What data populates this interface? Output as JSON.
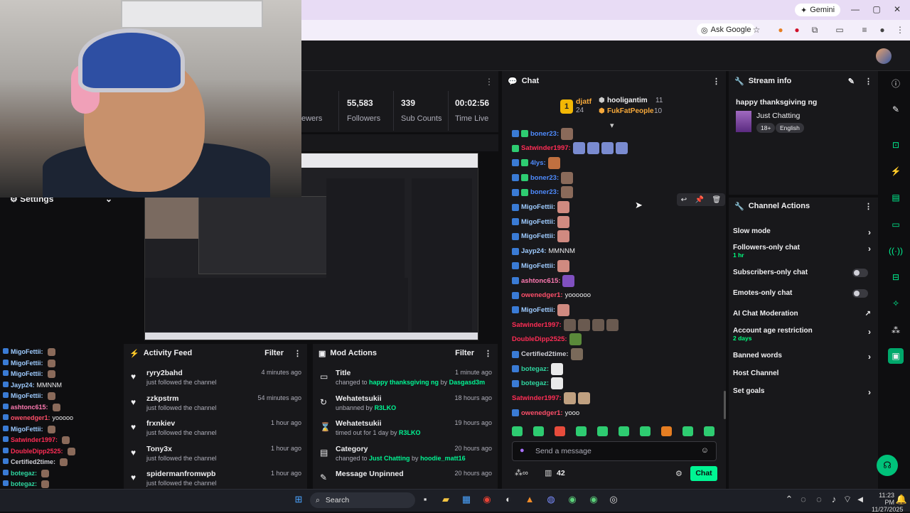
{
  "browser": {
    "gemini_label": "Gemini",
    "ask_google": "Ask Google"
  },
  "stats": [
    {
      "value": "",
      "label": "ewers"
    },
    {
      "value": "55,583",
      "label": "Followers"
    },
    {
      "value": "339",
      "label": "Sub Counts"
    },
    {
      "value": "00:02:56",
      "label": "Time Live"
    }
  ],
  "left": {
    "settings_label": "Settings",
    "chat": [
      {
        "user": "MigoFettii:",
        "color": "#9ecbff",
        "msg": ""
      },
      {
        "user": "MigoFettii:",
        "color": "#9ecbff",
        "msg": ""
      },
      {
        "user": "MigoFettii:",
        "color": "#9ecbff",
        "msg": ""
      },
      {
        "user": "Jayp24:",
        "color": "#9ecbff",
        "msg": "MMNNM"
      },
      {
        "user": "MigoFettii:",
        "color": "#9ecbff",
        "msg": ""
      },
      {
        "user": "ashtonc615:",
        "color": "#ff7ab2",
        "msg": ""
      },
      {
        "user": "owenedger1:",
        "color": "#ff4f6a",
        "msg": "yooooo"
      },
      {
        "user": "MigoFettii:",
        "color": "#9ecbff",
        "msg": ""
      },
      {
        "user": "Satwinder1997:",
        "color": "#ff2d55",
        "msg": ""
      },
      {
        "user": "DoubleDipp2525:",
        "color": "#ff2d55",
        "msg": ""
      },
      {
        "user": "Certified2time:",
        "color": "#cfcfd6",
        "msg": ""
      },
      {
        "user": "botegaz:",
        "color": "#2fd6a0",
        "msg": ""
      },
      {
        "user": "botegaz:",
        "color": "#2fd6a0",
        "msg": ""
      },
      {
        "user": "Satwinder1997",
        "color": "#ff2d55",
        "msg": ""
      },
      {
        "user": "owenedger1",
        "color": "#ff4f6a",
        "msg": "yooo"
      }
    ]
  },
  "activity_feed": {
    "title": "Activity Feed",
    "filter": "Filter",
    "items": [
      {
        "name": "ryry2bahd",
        "sub": "just followed the channel",
        "time": "4 minutes ago"
      },
      {
        "name": "zzkpstrm",
        "sub": "just followed the channel",
        "time": "54 minutes ago"
      },
      {
        "name": "frxnkiev",
        "sub": "just followed the channel",
        "time": "1 hour ago"
      },
      {
        "name": "Tony3x",
        "sub": "just followed the channel",
        "time": "1 hour ago"
      },
      {
        "name": "spidermanfromwpb",
        "sub": "just followed the channel",
        "time": "1 hour ago"
      }
    ]
  },
  "mod_actions": {
    "title": "Mod Actions",
    "filter": "Filter",
    "items": [
      {
        "title": "Title",
        "pre": "changed to ",
        "hl": "happy thanksgiving ng",
        "mid": " by ",
        "by": "Dasgasd3m",
        "time": "1 minute ago"
      },
      {
        "title": "Wehatetsukii",
        "pre": "unbanned by ",
        "hl": "",
        "mid": "",
        "by": "R3LKO",
        "time": "18 hours ago"
      },
      {
        "title": "Wehatetsukii",
        "pre": "timed out for 1 day by ",
        "hl": "",
        "mid": "",
        "by": "R3LKO",
        "time": "19 hours ago"
      },
      {
        "title": "Category",
        "pre": "changed to ",
        "hl": "Just Chatting",
        "mid": " by ",
        "by": "hoodie_matt16",
        "time": "20 hours ago"
      },
      {
        "title": "Message Unpinned",
        "pre": "",
        "hl": "",
        "mid": "",
        "by": "",
        "time": "20 hours ago"
      }
    ]
  },
  "chat": {
    "title": "Chat",
    "leaderboard": {
      "rank": "1",
      "first_user": "djatf",
      "first_count": "24",
      "second_user": "hooligantim",
      "second_count": "11",
      "third_user": "FukFatPeople",
      "third_count": "10"
    },
    "messages": [
      {
        "user": "boner23:",
        "color": "#4f8cff",
        "text": ""
      },
      {
        "user": "Satwinder1997:",
        "color": "#ff2d55",
        "text": ""
      },
      {
        "user": "4lys:",
        "color": "#4f8cff",
        "text": ""
      },
      {
        "user": "boner23:",
        "color": "#4f8cff",
        "text": ""
      },
      {
        "user": "boner23:",
        "color": "#4f8cff",
        "text": ""
      },
      {
        "user": "MigoFettii:",
        "color": "#9ecbff",
        "text": ""
      },
      {
        "user": "MigoFettii:",
        "color": "#9ecbff",
        "text": ""
      },
      {
        "user": "MigoFettii:",
        "color": "#9ecbff",
        "text": ""
      },
      {
        "user": "Jayp24:",
        "color": "#9ecbff",
        "text": "MMNNM"
      },
      {
        "user": "MigoFettii:",
        "color": "#9ecbff",
        "text": ""
      },
      {
        "user": "ashtonc615:",
        "color": "#ff7ab2",
        "text": ""
      },
      {
        "user": "owenedger1:",
        "color": "#ff4f6a",
        "text": "yoooooo"
      },
      {
        "user": "MigoFettii:",
        "color": "#9ecbff",
        "text": ""
      },
      {
        "user": "Satwinder1997:",
        "color": "#ff2d55",
        "text": ""
      },
      {
        "user": "DoubleDipp2525:",
        "color": "#ff2d55",
        "text": ""
      },
      {
        "user": "Certified2time:",
        "color": "#cfcfd6",
        "text": ""
      },
      {
        "user": "botegaz:",
        "color": "#2fd6a0",
        "text": ""
      },
      {
        "user": "botegaz:",
        "color": "#2fd6a0",
        "text": ""
      },
      {
        "user": "Satwinder1997:",
        "color": "#ff2d55",
        "text": ""
      },
      {
        "user": "owenedger1:",
        "color": "#ff4f6a",
        "text": "yooo"
      }
    ],
    "input_placeholder": "Send a message",
    "count": "42",
    "send_label": "Chat"
  },
  "stream_info": {
    "title": "Stream info",
    "stream_title": "happy thanksgiving ng",
    "category": "Just Chatting",
    "tags": [
      "18+",
      "English"
    ]
  },
  "channel_actions": {
    "title": "Channel Actions",
    "items": [
      {
        "label": "Slow mode",
        "sub": "",
        "control": "arrow"
      },
      {
        "label": "Followers-only chat",
        "sub": "1 hr",
        "control": "arrow"
      },
      {
        "label": "Subscribers-only chat",
        "sub": "",
        "control": "toggle"
      },
      {
        "label": "Emotes-only chat",
        "sub": "",
        "control": "toggle"
      },
      {
        "label": "AI Chat Moderation",
        "sub": "",
        "control": "external"
      },
      {
        "label": "Account age restriction",
        "sub": "2 days",
        "control": "arrow"
      },
      {
        "label": "Banned words",
        "sub": "",
        "control": "arrow"
      },
      {
        "label": "Host Channel",
        "sub": "",
        "control": "none"
      },
      {
        "label": "Set goals",
        "sub": "",
        "control": "arrow"
      }
    ]
  },
  "taskbar": {
    "search": "Search",
    "time": "11:23 PM",
    "date": "11/27/2025"
  },
  "colors": {
    "accent_green": "#00f593",
    "panel": "#18181b",
    "bg": "#0e0e10"
  }
}
